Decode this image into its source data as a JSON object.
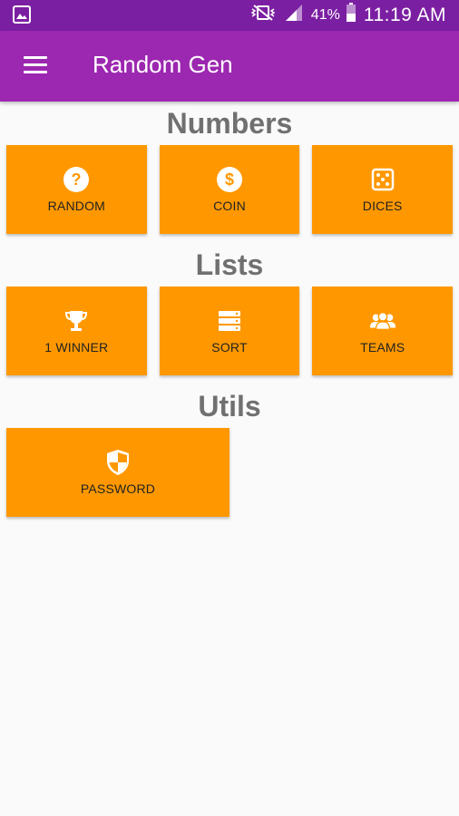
{
  "status_bar": {
    "battery_percent": "41%",
    "time": "11:19 AM",
    "icons": [
      "image-icon",
      "mute-vibrate-icon",
      "signal-icon",
      "battery-icon"
    ]
  },
  "app_bar": {
    "title": "Random Gen",
    "menu_icon": "hamburger-menu-icon"
  },
  "sections": {
    "numbers": {
      "title": "Numbers",
      "items": [
        {
          "label": "RANDOM",
          "icon": "question-circle-icon"
        },
        {
          "label": "COIN",
          "icon": "dollar-circle-icon"
        },
        {
          "label": "DICES",
          "icon": "dice-icon"
        }
      ]
    },
    "lists": {
      "title": "Lists",
      "items": [
        {
          "label": "1 WINNER",
          "icon": "trophy-icon"
        },
        {
          "label": "SORT",
          "icon": "sort-list-icon"
        },
        {
          "label": "TEAMS",
          "icon": "teams-icon"
        }
      ]
    },
    "utils": {
      "title": "Utils",
      "items": [
        {
          "label": "PASSWORD",
          "icon": "shield-icon"
        }
      ]
    }
  },
  "colors": {
    "status_bar": "#7b1fa2",
    "app_bar": "#9c27b0",
    "tile": "#ff9800",
    "section_title": "#707070",
    "background": "#fafafa"
  }
}
